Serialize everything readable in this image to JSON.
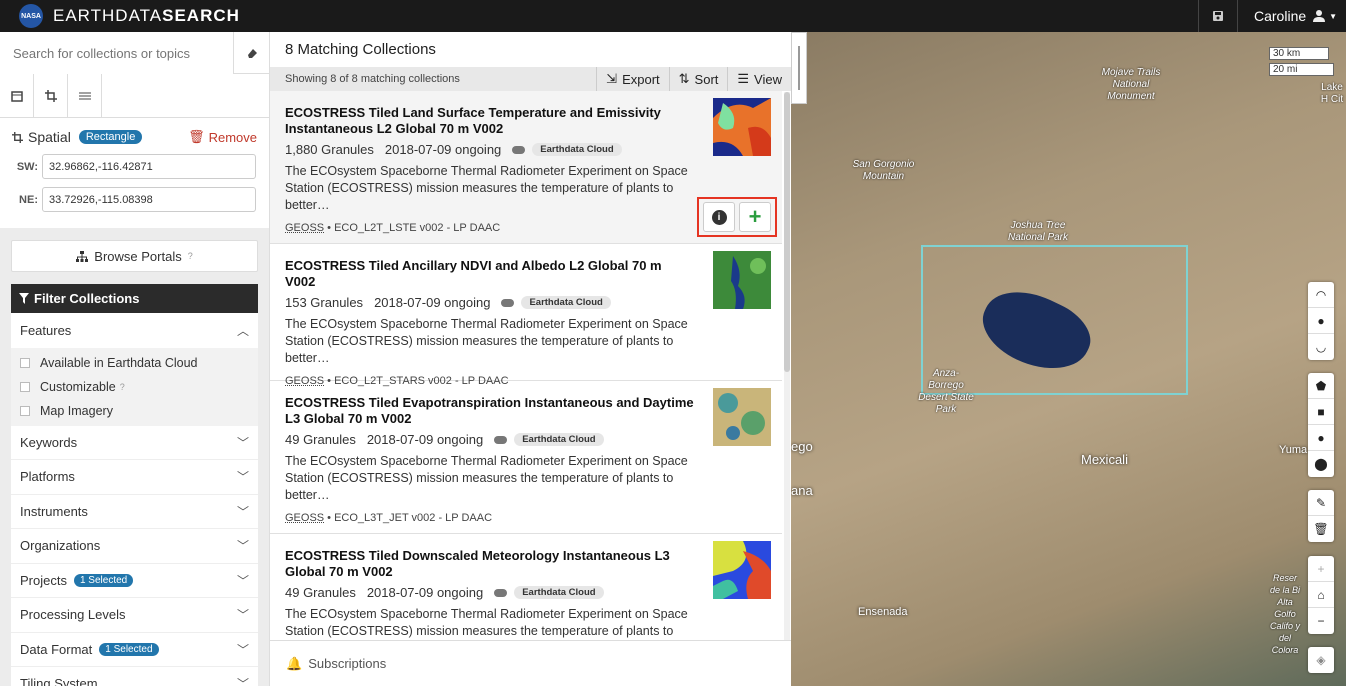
{
  "header": {
    "logo_text": "NASA",
    "brand_light": "EARTHDATA",
    "brand_bold": "SEARCH",
    "user_name": "Caroline"
  },
  "search": {
    "placeholder": "Search for collections or topics"
  },
  "spatial": {
    "label": "Spatial",
    "type_badge": "Rectangle",
    "remove_label": "Remove",
    "sw_label": "SW:",
    "sw_value": "32.96862,-116.42871",
    "ne_label": "NE:",
    "ne_value": "33.72926,-115.08398"
  },
  "portals": {
    "label": "Browse Portals"
  },
  "filters": {
    "title": "Filter Collections",
    "features_label": "Features",
    "feature_options": [
      {
        "label": "Available in Earthdata Cloud"
      },
      {
        "label": "Customizable"
      },
      {
        "label": "Map Imagery"
      }
    ],
    "facets": [
      {
        "label": "Keywords",
        "badge": ""
      },
      {
        "label": "Platforms",
        "badge": ""
      },
      {
        "label": "Instruments",
        "badge": ""
      },
      {
        "label": "Organizations",
        "badge": ""
      },
      {
        "label": "Projects",
        "badge": "1 Selected"
      },
      {
        "label": "Processing Levels",
        "badge": ""
      },
      {
        "label": "Data Format",
        "badge": "1 Selected"
      },
      {
        "label": "Tiling System",
        "badge": ""
      }
    ]
  },
  "results": {
    "title": "8 Matching Collections",
    "showing": "Showing 8 of 8 matching collections",
    "export_label": "Export",
    "sort_label": "Sort",
    "view_label": "View",
    "items": [
      {
        "title": "ECOSTRESS Tiled Land Surface Temperature and Emissivity Instantaneous L2 Global 70 m V002",
        "granules": "1,880 Granules",
        "dates": "2018-07-09 ongoing",
        "cloud": "Earthdata Cloud",
        "desc": "The ECOsystem Spaceborne Thermal Radiometer Experiment on Space Station (ECOSTRESS) mission measures the temperature of plants to better…",
        "geoss": "GEOSS",
        "ids": " • ECO_L2T_LSTE v002 - LP DAAC",
        "info_icon": "info-icon",
        "add_icon": "plus-icon"
      },
      {
        "title": "ECOSTRESS Tiled Ancillary NDVI and Albedo L2 Global 70 m V002",
        "granules": "153 Granules",
        "dates": "2018-07-09 ongoing",
        "cloud": "Earthdata Cloud",
        "desc": "The ECOsystem Spaceborne Thermal Radiometer Experiment on Space Station (ECOSTRESS) mission measures the temperature of plants to better…",
        "geoss": "GEOSS",
        "ids": " • ECO_L2T_STARS v002 - LP DAAC"
      },
      {
        "title": "ECOSTRESS Tiled Evapotranspiration Instantaneous and Daytime L3 Global 70 m V002",
        "granules": "49 Granules",
        "dates": "2018-07-09 ongoing",
        "cloud": "Earthdata Cloud",
        "desc": "The ECOsystem Spaceborne Thermal Radiometer Experiment on Space Station (ECOSTRESS) mission measures the temperature of plants to better…",
        "geoss": "GEOSS",
        "ids": " • ECO_L3T_JET v002 - LP DAAC"
      },
      {
        "title": "ECOSTRESS Tiled Downscaled Meteorology Instantaneous L3 Global 70 m V002",
        "granules": "49 Granules",
        "dates": "2018-07-09 ongoing",
        "cloud": "Earthdata Cloud",
        "desc": "The ECOsystem Spaceborne Thermal Radiometer Experiment on Space Station (ECOSTRESS) mission measures the temperature of plants to better…"
      }
    ]
  },
  "subscriptions": {
    "label": "Subscriptions"
  },
  "map": {
    "scale_km": "30 km",
    "scale_mi": "20 mi",
    "labels": {
      "mojave": "Mojave Trails National Monument",
      "san_gorgonio": "San Gorgonio Mountain",
      "joshua": "Joshua Tree National Park",
      "anza": "Anza-Borrego Desert State Park",
      "mexicali": "Mexicali",
      "yuma": "Yuma",
      "ensenada": "Ensenada",
      "ego": "ego",
      "ana": "ana",
      "lake": "Lake H Cit",
      "reserva": "Reser de la Bi Alta Golfo Califo y del Colora"
    },
    "colors": {
      "selection": "#7fd2d2"
    }
  }
}
